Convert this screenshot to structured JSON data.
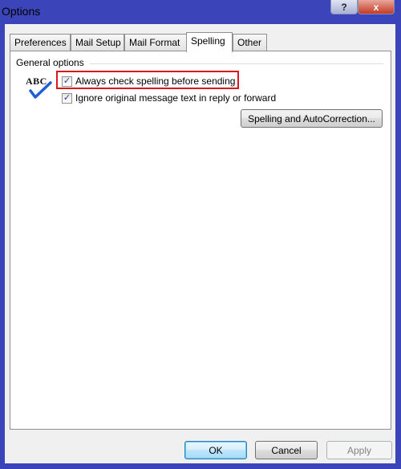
{
  "window": {
    "title": "Options",
    "help_label": "?",
    "close_label": "x"
  },
  "tabs": [
    {
      "label": "Preferences"
    },
    {
      "label": "Mail Setup"
    },
    {
      "label": "Mail Format"
    },
    {
      "label": "Spelling",
      "active": true
    },
    {
      "label": "Other"
    }
  ],
  "spelling": {
    "group_label": "General options",
    "abc_label": "ABC",
    "always_check": {
      "label": "Always check spelling before sending",
      "checked": true
    },
    "ignore_original": {
      "label": "Ignore original message text in reply or forward",
      "checked": true
    },
    "autocorrect_button": "Spelling and AutoCorrection..."
  },
  "footer": {
    "ok": "OK",
    "cancel": "Cancel",
    "apply": "Apply"
  },
  "colors": {
    "title_bar": "#3b44b8",
    "highlight_box": "#d7191c",
    "check_blue": "#1f5fd4"
  },
  "icons": {
    "spelling": "abc-checkmark-icon",
    "checkbox": "check-mark-icon"
  }
}
